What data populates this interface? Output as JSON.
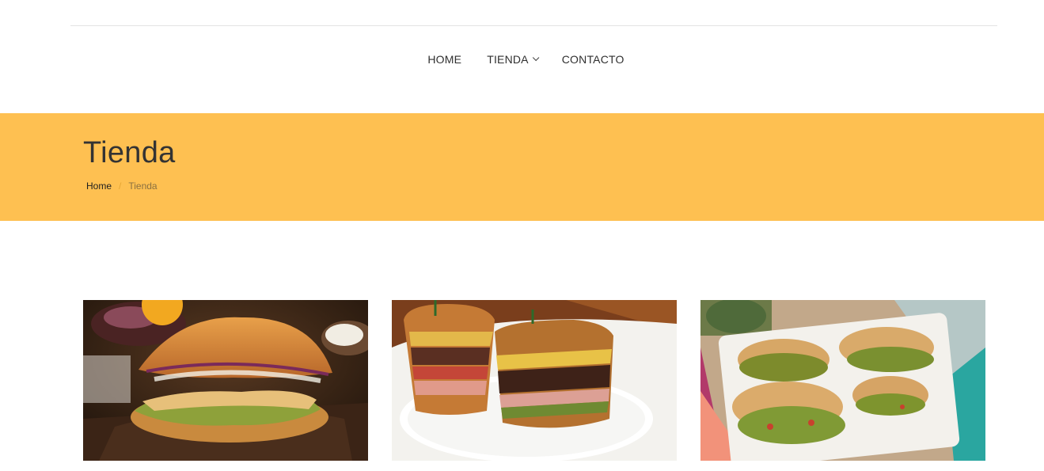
{
  "nav": {
    "items": [
      {
        "label": "HOME"
      },
      {
        "label": "TIENDA"
      },
      {
        "label": "CONTACTO"
      }
    ]
  },
  "banner": {
    "title": "Tienda",
    "breadcrumb": {
      "home": "Home",
      "separator": "/",
      "current": "Tienda"
    },
    "color": "#fec051"
  },
  "products": [
    {
      "image": "torta-milanesa-photo"
    },
    {
      "image": "club-sandwich-photo"
    },
    {
      "image": "gorditas-salsa-verde-photo"
    }
  ]
}
